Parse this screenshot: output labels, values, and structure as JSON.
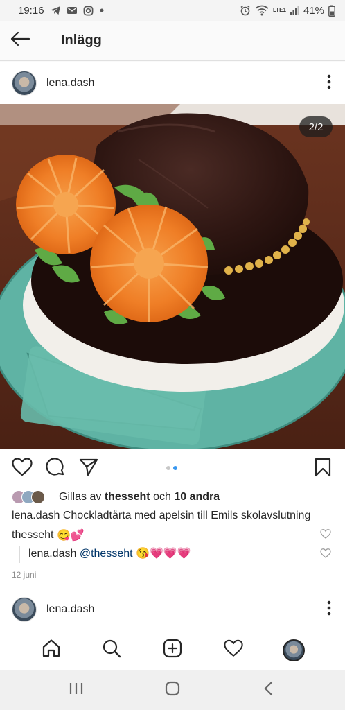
{
  "status_bar": {
    "time": "19:16",
    "battery_percent": "41%",
    "network_label": "LTE1",
    "notification_icons": [
      "telegram-icon",
      "mail-icon",
      "instagram-icon",
      "dot-icon"
    ],
    "system_icons": [
      "alarm-icon",
      "wifi-icon",
      "signal-icon",
      "battery-icon"
    ]
  },
  "header": {
    "title": "Inlägg"
  },
  "post": {
    "username": "lena.dash",
    "image_counter": "2/2",
    "carousel": {
      "total": 2,
      "active": 2
    },
    "likes": {
      "prefix": "Gillas av",
      "first_user": "thesseht",
      "conjunction": "och",
      "others": "10 andra"
    },
    "caption": {
      "username": "lena.dash",
      "text": "Chockladtårta med apelsin till Emils skolavslutning"
    },
    "comments": [
      {
        "username": "thesseht",
        "text": "😋💕"
      }
    ],
    "reply": {
      "username": "lena.dash",
      "mention": "@thesseht",
      "text": "😘💗💗💗"
    },
    "date": "12 juni"
  },
  "next_post": {
    "username": "lena.dash"
  },
  "bottom_nav": [
    "home-icon",
    "search-icon",
    "add-post-icon",
    "activity-heart-icon",
    "profile-avatar"
  ],
  "colors": {
    "accent_blue": "#3897f0",
    "text": "#262626",
    "muted": "#8e8e8e"
  }
}
